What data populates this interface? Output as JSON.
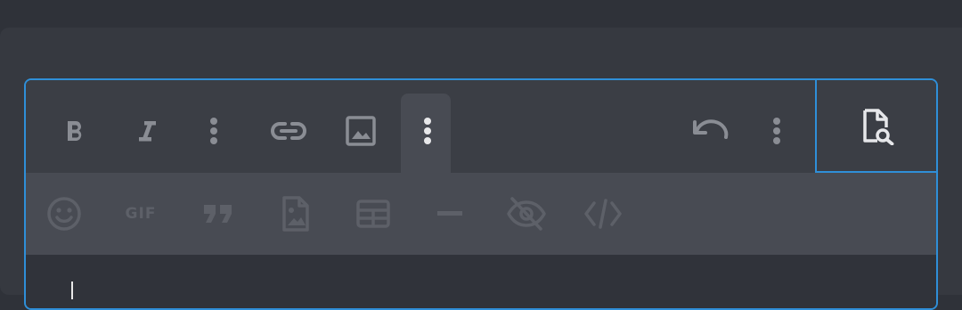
{
  "toolbar": {
    "primary": [
      {
        "name": "bold",
        "icon": "bold-icon"
      },
      {
        "name": "italic",
        "icon": "italic-icon"
      },
      {
        "name": "more-formatting",
        "icon": "vertical-dots-icon"
      },
      {
        "name": "link",
        "icon": "link-icon"
      },
      {
        "name": "image",
        "icon": "image-icon"
      },
      {
        "name": "more-insert",
        "icon": "vertical-dots-icon",
        "active": true
      },
      {
        "name": "undo",
        "icon": "undo-icon"
      },
      {
        "name": "more-options",
        "icon": "vertical-dots-icon"
      }
    ],
    "preview": {
      "icon": "document-search-icon"
    },
    "secondary": [
      {
        "name": "emoji",
        "icon": "smiley-icon"
      },
      {
        "name": "gif",
        "label": "GIF"
      },
      {
        "name": "quote",
        "icon": "quote-icon"
      },
      {
        "name": "attach-image",
        "icon": "image-file-icon"
      },
      {
        "name": "table",
        "icon": "table-icon"
      },
      {
        "name": "horizontal-rule",
        "icon": "horizontal-rule-icon"
      },
      {
        "name": "spoiler",
        "icon": "eye-off-icon"
      },
      {
        "name": "code",
        "icon": "code-icon"
      }
    ]
  },
  "editor": {
    "value": ""
  },
  "colors": {
    "accent": "#2f8fd8",
    "toolbar": "#3b3e45",
    "subtoolbar": "#484b53",
    "icon": "#8a8d94",
    "icon_dim": "#5d6068"
  }
}
